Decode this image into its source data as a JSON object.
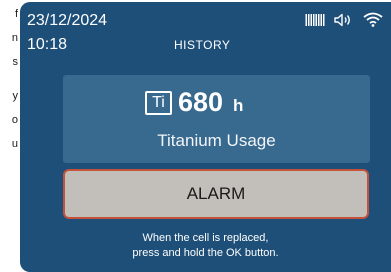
{
  "side_text": [
    "f",
    "n",
    "s",
    "y",
    "o",
    "u"
  ],
  "header": {
    "date": "23/12/2024",
    "time": "10:18",
    "title": "HISTORY",
    "icons": [
      "battery-icon",
      "speaker-icon",
      "wifi-icon"
    ]
  },
  "usage": {
    "element_symbol": "Ti",
    "hours": "680",
    "unit": "h",
    "label": "Titanium Usage"
  },
  "alarm": {
    "label": "ALARM",
    "border_color": "#c4523b"
  },
  "instructions": {
    "line1": "When the cell is replaced,",
    "line2": "press and hold the OK button."
  },
  "colors": {
    "screen_bg": "#1d4f78",
    "card_bg": "#38698f",
    "button_bg": "#c2bfbb"
  }
}
